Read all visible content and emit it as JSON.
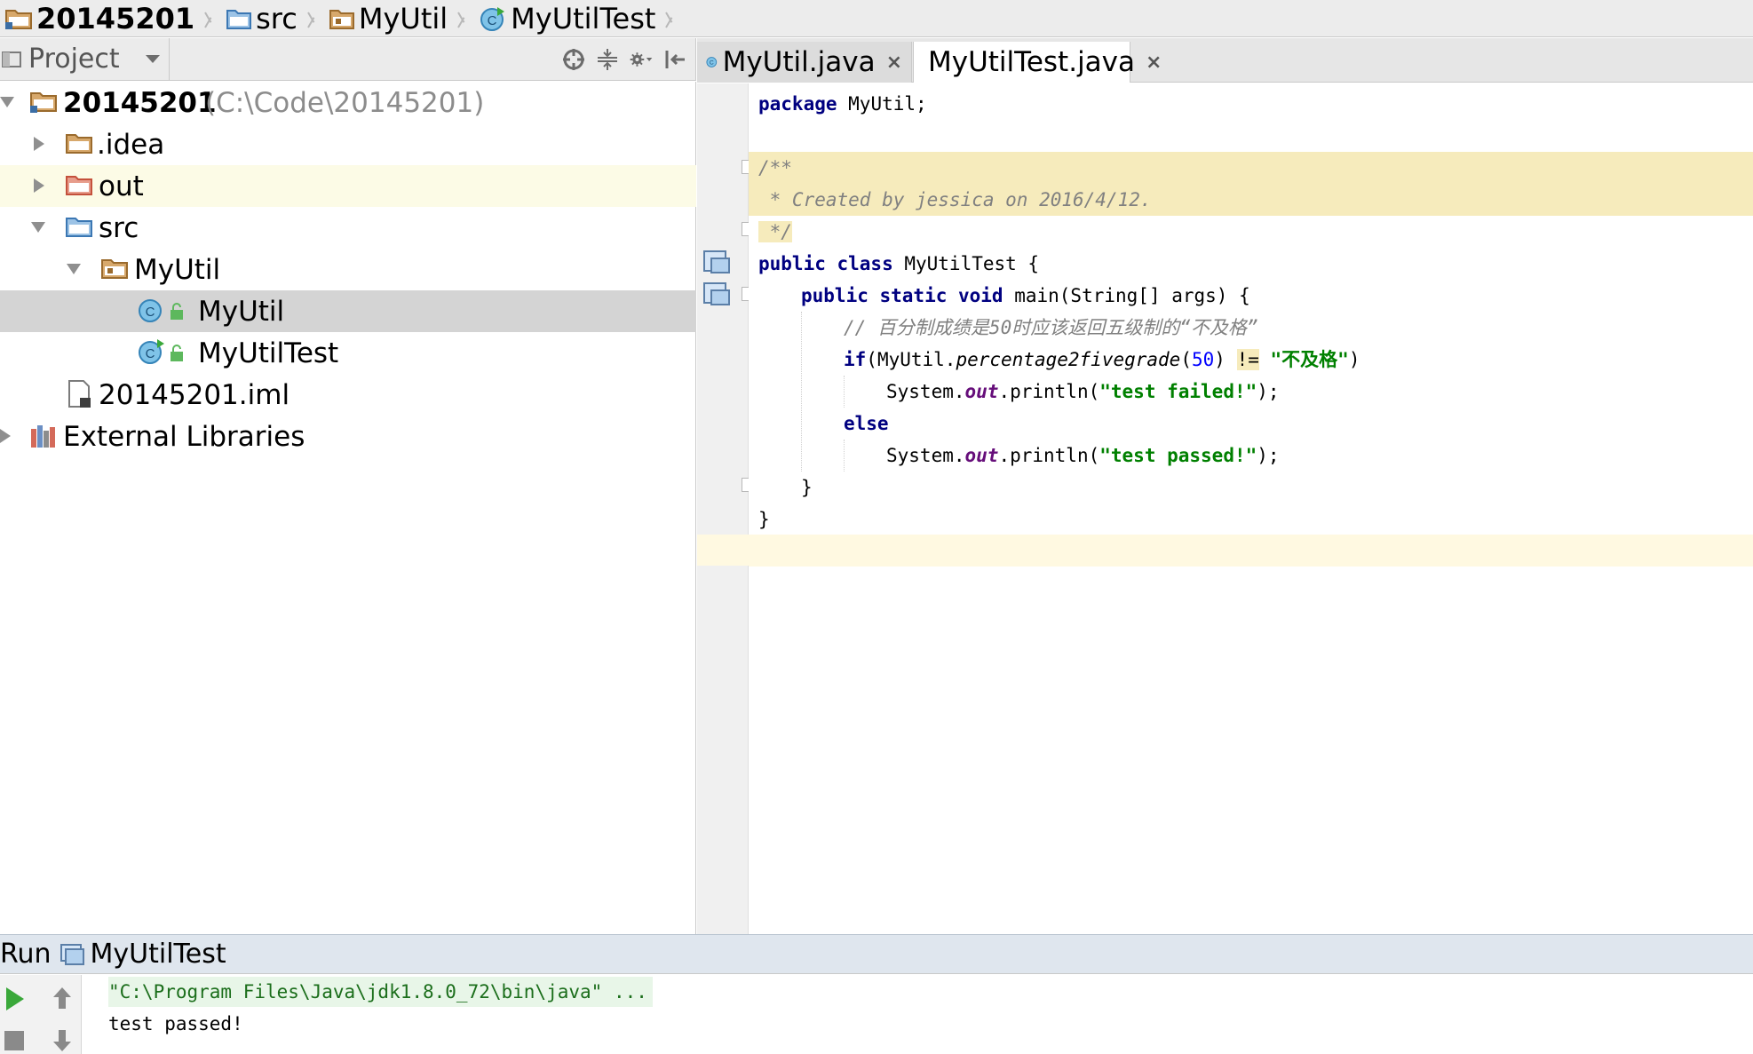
{
  "breadcrumb": {
    "items": [
      {
        "label": "20145201",
        "icon": "project-folder-icon"
      },
      {
        "label": "src",
        "icon": "source-folder-icon"
      },
      {
        "label": "MyUtil",
        "icon": "package-folder-icon"
      },
      {
        "label": "MyUtilTest",
        "icon": "class-icon"
      }
    ]
  },
  "project_panel": {
    "title": "Project",
    "tools": [
      "locate-icon",
      "collapse-all-icon",
      "gear-icon",
      "hide-panel-icon"
    ],
    "tree": [
      {
        "label": "20145201",
        "suffix": "(C:\\Code\\20145201)"
      },
      {
        "label": ".idea"
      },
      {
        "label": "out"
      },
      {
        "label": "src"
      },
      {
        "label": "MyUtil"
      },
      {
        "label": "MyUtil"
      },
      {
        "label": "MyUtilTest"
      },
      {
        "label": "20145201.iml"
      },
      {
        "label": "External Libraries"
      }
    ]
  },
  "editor": {
    "tabs": [
      {
        "label": "MyUtil.java",
        "close": "×",
        "active": false
      },
      {
        "label": "MyUtilTest.java",
        "close": "×",
        "active": true
      }
    ],
    "code": {
      "package_kw": "package",
      "package_name": " MyUtil;",
      "doc_open": "/**",
      "doc_body": " * Created by jessica on 2016/4/12.",
      "doc_close": " */",
      "class_kw": "public class",
      "class_name": " MyUtilTest {",
      "main_kw": "public static void",
      "main_sig": " main(String[] args) {",
      "comment": "// 百分制成绩是50时应该返回五级制的“不及格”",
      "if_kw": "if",
      "if_open": "(MyUtil.",
      "if_method": "percentage2fivegrade",
      "if_paren": "(",
      "if_num": "50",
      "if_close": ") ",
      "if_neq": "!=",
      "if_space": " ",
      "if_str": "\"不及格\"",
      "if_end": ")",
      "println1_pre": "System.",
      "println1_field": "out",
      "println1_mid": ".println(",
      "println1_str": "\"test failed!\"",
      "println1_end": ");",
      "else_kw": "else",
      "println2_pre": "System.",
      "println2_field": "out",
      "println2_mid": ".println(",
      "println2_str": "\"test passed!\"",
      "println2_end": ");",
      "close_method": "}",
      "close_class": "}"
    }
  },
  "run_panel": {
    "label": "Run",
    "config": "MyUtilTest",
    "output": [
      "\"C:\\Program Files\\Java\\jdk1.8.0_72\\bin\\java\" ...",
      "test passed!"
    ]
  },
  "colors": {
    "keyword": "#000080",
    "string": "#008000",
    "comment": "#808080",
    "number": "#0000ff",
    "field": "#660e7a",
    "doc_highlight": "#f6ebbc",
    "selection": "#d4d4d4"
  }
}
